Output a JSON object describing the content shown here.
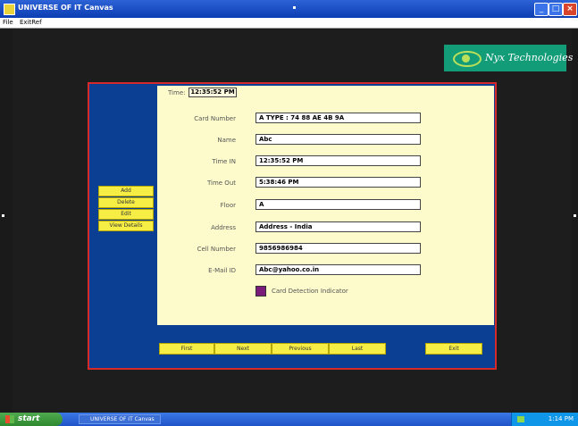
{
  "window": {
    "title": "UNIVERSE OF IT Canvas",
    "min_label": "_",
    "max_label": "□",
    "close_label": "×"
  },
  "menu": {
    "file_label": "File",
    "exit_label": "ExitRef"
  },
  "logo": {
    "text": "Nyx Technologies"
  },
  "form": {
    "time_label": "Time:",
    "time_value": "12:35:52 PM",
    "fields": [
      {
        "label": "Card Number",
        "value": "A TYPE : 74 88 AE 4B 9A"
      },
      {
        "label": "Name",
        "value": "Abc"
      },
      {
        "label": "Time IN",
        "value": "12:35:52 PM"
      },
      {
        "label": "Time Out",
        "value": "5:38:46 PM"
      },
      {
        "label": "Floor",
        "value": "A"
      },
      {
        "label": "Address",
        "value": "Address - India"
      },
      {
        "label": "Cell Number",
        "value": "9856986984"
      },
      {
        "label": "E-Mail ID",
        "value": "Abc@yahoo.co.in"
      }
    ],
    "checkbox_label": "Card Detection Indicator"
  },
  "side_menu": [
    "Add",
    "Delete",
    "Edit",
    "View Details"
  ],
  "bottom_buttons": {
    "first": "First",
    "next": "Next",
    "previous": "Previous",
    "last": "Last",
    "exit": "Exit"
  },
  "taskbar": {
    "start_label": "start",
    "task_label": "UNIVERSE OF IT Canvas",
    "clock": "1:14 PM"
  },
  "colors": {
    "panel": "#fdfbcb",
    "frame": "#0b3f94",
    "frame_border": "#d62a2a",
    "button": "#f7ee45",
    "logo_bg": "#129c78"
  }
}
